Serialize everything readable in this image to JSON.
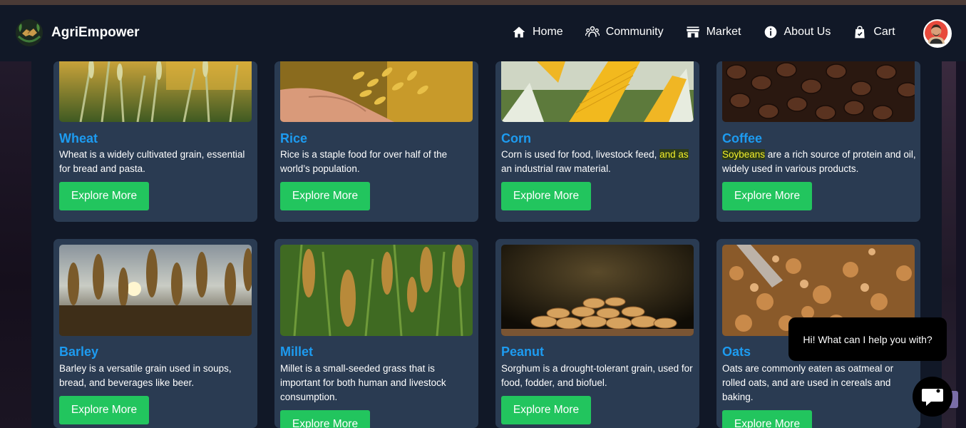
{
  "brand": {
    "name": "AgriEmpower",
    "logo_icon": "handshake-leaf-icon"
  },
  "nav": {
    "items": [
      {
        "label": "Home",
        "icon": "home-icon"
      },
      {
        "label": "Community",
        "icon": "people-icon"
      },
      {
        "label": "Market",
        "icon": "store-icon"
      },
      {
        "label": "About Us",
        "icon": "info-icon"
      },
      {
        "label": "Cart",
        "icon": "shopping-bag-icon"
      }
    ]
  },
  "cards": [
    {
      "title": "Wheat",
      "desc": "Wheat is a widely cultivated grain, essential for bread and pasta.",
      "button": "Explore More"
    },
    {
      "title": "Rice",
      "desc": "Rice is a staple food for over half of the world’s population.",
      "button": "Explore More"
    },
    {
      "title": "Corn",
      "desc_pre": "Corn is used for food, livestock feed, ",
      "desc_hl": "and as ",
      "desc_post": "an industrial raw material.",
      "button": "Explore More"
    },
    {
      "title": "Coffee",
      "desc_hl": "Soybeans",
      "desc_post": " are a rich source of protein and oil, widely used in various products.",
      "button": "Explore More"
    },
    {
      "title": "Barley",
      "desc": "Barley is a versatile grain used in soups, bread, and beverages like beer.",
      "button": "Explore More"
    },
    {
      "title": "Millet",
      "desc": "Millet is a small-seeded grass that is important for both human and livestock consumption.",
      "button": "Explore More"
    },
    {
      "title": "Peanut",
      "desc": "Sorghum is a drought-tolerant grain, used for food, fodder, and biofuel.",
      "button": "Explore More"
    },
    {
      "title": "Oats",
      "desc": "Oats are commonly eaten as oatmeal or rolled oats, and are used in cereals and baking.",
      "button": "Explore More"
    }
  ],
  "chat": {
    "message": "Hi! What can I help you with?",
    "icon": "chat-icon"
  },
  "colors": {
    "accent_title": "#1d9bf0",
    "button": "#22c55e",
    "card": "#2a3b52",
    "nav": "#111827"
  }
}
